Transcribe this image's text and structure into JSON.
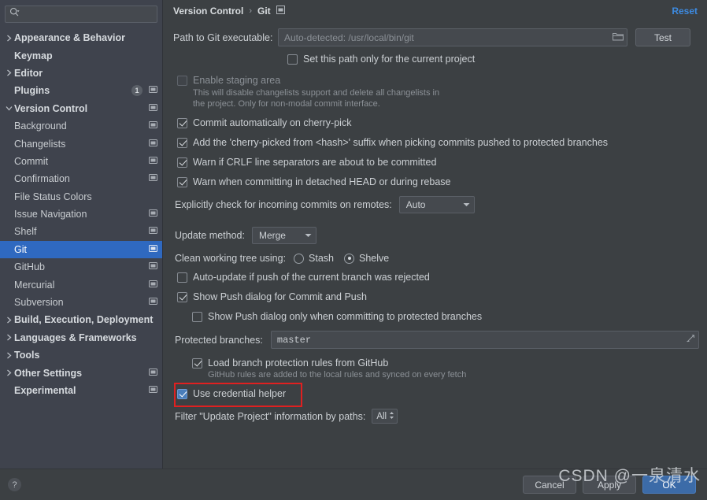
{
  "sidebar": {
    "search": {
      "placeholder": "",
      "icon": "search-icon"
    },
    "items": [
      {
        "label": "Appearance & Behavior",
        "indent": 0,
        "arrow": "collapsed",
        "bold": true,
        "config_icon": false,
        "badge": null,
        "selected": false
      },
      {
        "label": "Keymap",
        "indent": 0,
        "arrow": "none",
        "bold": true,
        "config_icon": false,
        "badge": null,
        "selected": false
      },
      {
        "label": "Editor",
        "indent": 0,
        "arrow": "collapsed",
        "bold": true,
        "config_icon": false,
        "badge": null,
        "selected": false
      },
      {
        "label": "Plugins",
        "indent": 0,
        "arrow": "none",
        "bold": true,
        "config_icon": true,
        "badge": "1",
        "selected": false
      },
      {
        "label": "Version Control",
        "indent": 0,
        "arrow": "expanded",
        "bold": true,
        "config_icon": true,
        "badge": null,
        "selected": false
      },
      {
        "label": "Background",
        "indent": 1,
        "arrow": "none",
        "bold": false,
        "config_icon": true,
        "badge": null,
        "selected": false
      },
      {
        "label": "Changelists",
        "indent": 1,
        "arrow": "none",
        "bold": false,
        "config_icon": true,
        "badge": null,
        "selected": false
      },
      {
        "label": "Commit",
        "indent": 1,
        "arrow": "none",
        "bold": false,
        "config_icon": true,
        "badge": null,
        "selected": false
      },
      {
        "label": "Confirmation",
        "indent": 1,
        "arrow": "none",
        "bold": false,
        "config_icon": true,
        "badge": null,
        "selected": false
      },
      {
        "label": "File Status Colors",
        "indent": 1,
        "arrow": "none",
        "bold": false,
        "config_icon": false,
        "badge": null,
        "selected": false
      },
      {
        "label": "Issue Navigation",
        "indent": 1,
        "arrow": "none",
        "bold": false,
        "config_icon": true,
        "badge": null,
        "selected": false
      },
      {
        "label": "Shelf",
        "indent": 1,
        "arrow": "none",
        "bold": false,
        "config_icon": true,
        "badge": null,
        "selected": false
      },
      {
        "label": "Git",
        "indent": 1,
        "arrow": "none",
        "bold": false,
        "config_icon": true,
        "badge": null,
        "selected": true
      },
      {
        "label": "GitHub",
        "indent": 1,
        "arrow": "none",
        "bold": false,
        "config_icon": true,
        "badge": null,
        "selected": false
      },
      {
        "label": "Mercurial",
        "indent": 1,
        "arrow": "none",
        "bold": false,
        "config_icon": true,
        "badge": null,
        "selected": false
      },
      {
        "label": "Subversion",
        "indent": 1,
        "arrow": "collapsed",
        "bold": false,
        "config_icon": true,
        "badge": null,
        "selected": false
      },
      {
        "label": "Build, Execution, Deployment",
        "indent": 0,
        "arrow": "collapsed",
        "bold": true,
        "config_icon": false,
        "badge": null,
        "selected": false
      },
      {
        "label": "Languages & Frameworks",
        "indent": 0,
        "arrow": "collapsed",
        "bold": true,
        "config_icon": false,
        "badge": null,
        "selected": false
      },
      {
        "label": "Tools",
        "indent": 0,
        "arrow": "collapsed",
        "bold": true,
        "config_icon": false,
        "badge": null,
        "selected": false
      },
      {
        "label": "Other Settings",
        "indent": 0,
        "arrow": "collapsed",
        "bold": true,
        "config_icon": true,
        "badge": null,
        "selected": false
      },
      {
        "label": "Experimental",
        "indent": 0,
        "arrow": "none",
        "bold": true,
        "config_icon": true,
        "badge": null,
        "selected": false
      }
    ]
  },
  "header": {
    "breadcrumb_parent": "Version Control",
    "breadcrumb_sep": "›",
    "breadcrumb_current": "Git",
    "settings_icon": "project-scope-icon",
    "reset_label": "Reset"
  },
  "main": {
    "git_path": {
      "label": "Path to Git executable:",
      "value": "",
      "placeholder": "Auto-detected: /usr/local/bin/git",
      "browse_icon": "folder-icon",
      "test_button": "Test"
    },
    "set_path_project": {
      "label": "Set this path only for the current project",
      "checked": false
    },
    "enable_staging": {
      "label": "Enable staging area",
      "checked": false,
      "disabled": true,
      "hint_line1": "This will disable changelists support and delete all changelists in",
      "hint_line2": "the project. Only for non-modal commit interface."
    },
    "checkboxes": [
      {
        "label": "Commit automatically on cherry-pick",
        "checked": true
      },
      {
        "label": "Add the 'cherry-picked from <hash>' suffix when picking commits pushed to protected branches",
        "checked": true
      },
      {
        "label": "Warn if CRLF line separators are about to be committed",
        "checked": true
      },
      {
        "label": "Warn when committing in detached HEAD or during rebase",
        "checked": true
      }
    ],
    "incoming_commits": {
      "label": "Explicitly check for incoming commits on remotes:",
      "value": "Auto"
    },
    "update_method": {
      "label": "Update method:",
      "value": "Merge"
    },
    "clean_working_tree": {
      "label": "Clean working tree using:",
      "options": [
        {
          "label": "Stash",
          "selected": false
        },
        {
          "label": "Shelve",
          "selected": true
        }
      ]
    },
    "auto_update": {
      "label": "Auto-update if push of the current branch was rejected",
      "checked": false
    },
    "show_push_dialog": {
      "label": "Show Push dialog for Commit and Push",
      "checked": true
    },
    "show_push_protected": {
      "label": "Show Push dialog only when committing to protected branches",
      "checked": false
    },
    "protected_branches": {
      "label": "Protected branches:",
      "value": "master",
      "expand_icon": "expand-icon"
    },
    "load_branch_rules": {
      "label": "Load branch protection rules from GitHub",
      "checked": true,
      "hint": "GitHub rules are added to the local rules and synced on every fetch"
    },
    "use_credential_helper": {
      "label": "Use credential helper",
      "checked": true,
      "highlighted": true,
      "highlight_color": "#e02020"
    },
    "filter_paths": {
      "label": "Filter \"Update Project\" information by paths:",
      "value": "All"
    }
  },
  "footer": {
    "help_icon": "help-icon",
    "help_label": "?",
    "buttons": [
      {
        "label": "Cancel",
        "primary": false
      },
      {
        "label": "Apply",
        "primary": false
      },
      {
        "label": "OK",
        "primary": true
      }
    ],
    "watermark": "CSDN @一泉清水"
  },
  "colors": {
    "accent_blue": "#3d8ae0",
    "selection_blue": "#2f69c0",
    "primary_button": "#3c6ba8",
    "background": "#3c4043",
    "sidebar_background": "#3f434d",
    "highlight_red": "#e02020"
  }
}
